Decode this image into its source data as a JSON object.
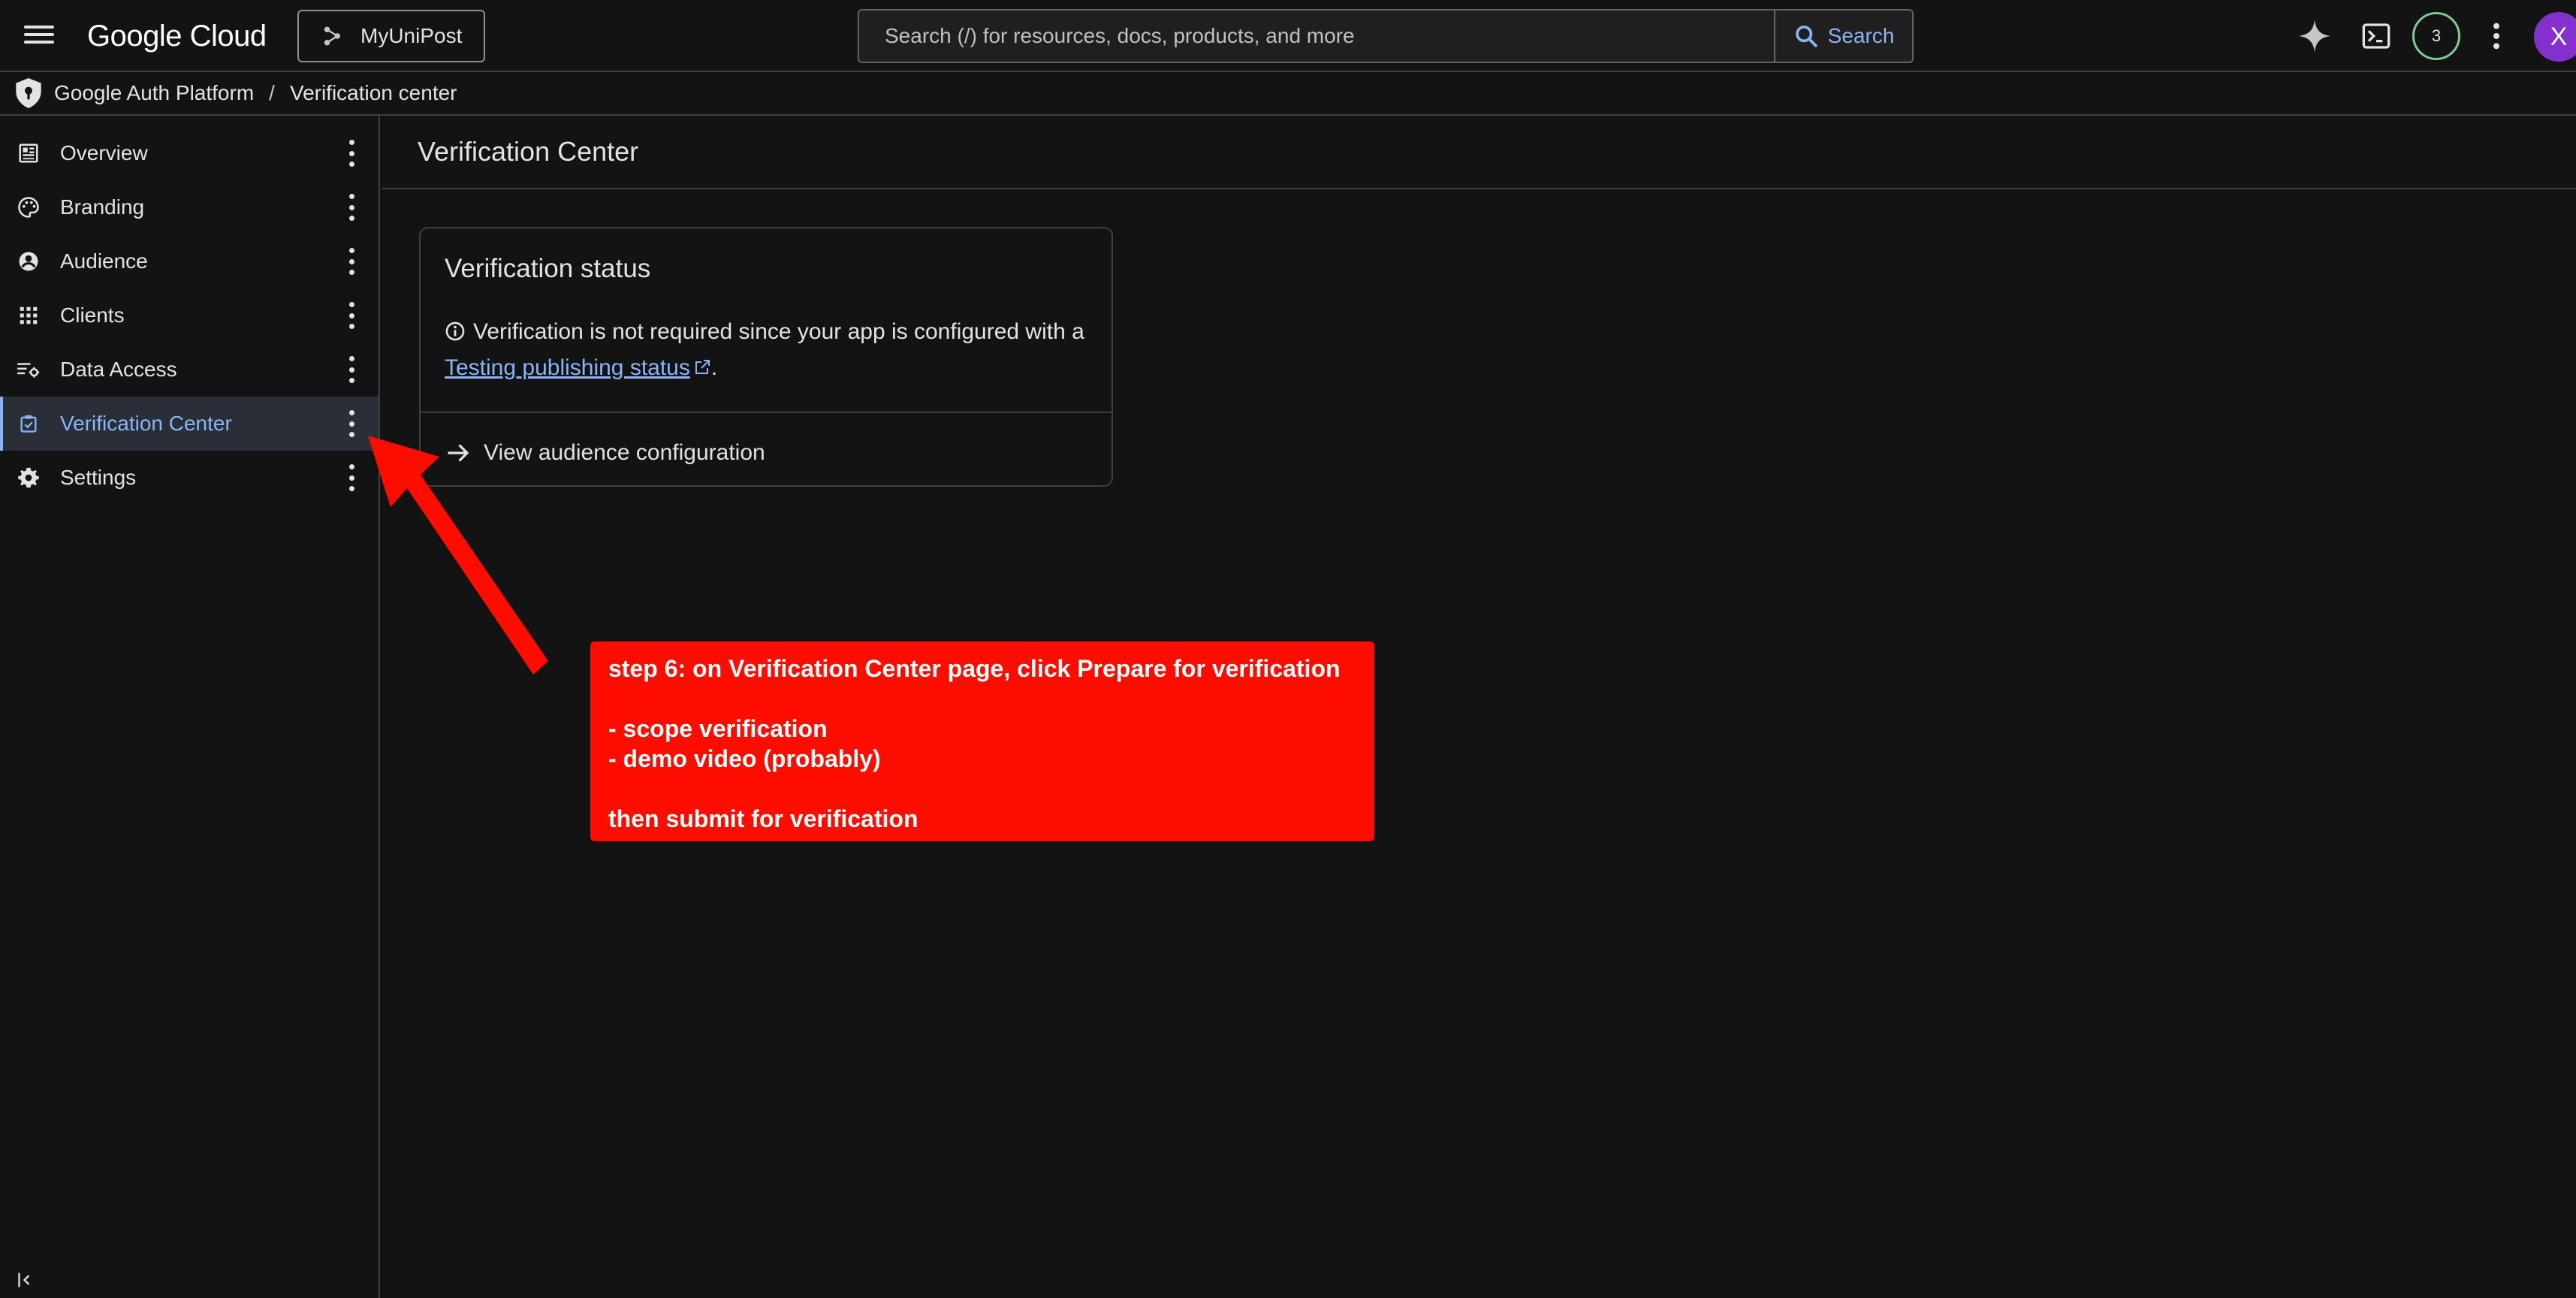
{
  "header": {
    "logo": "Google Cloud",
    "project_name": "MyUniPost",
    "search_placeholder": "Search (/) for resources, docs, products, and more",
    "search_button": "Search",
    "notification_count": "3",
    "avatar_initial": "X"
  },
  "breadcrumb": {
    "root": "Google Auth Platform",
    "current": "Verification center"
  },
  "sidebar": {
    "items": [
      {
        "label": "Overview",
        "icon": "dashboard-icon"
      },
      {
        "label": "Branding",
        "icon": "palette-icon"
      },
      {
        "label": "Audience",
        "icon": "account-circle-icon"
      },
      {
        "label": "Clients",
        "icon": "apps-grid-icon"
      },
      {
        "label": "Data Access",
        "icon": "tune-list-icon"
      },
      {
        "label": "Verification Center",
        "icon": "verified-check-icon",
        "active": true
      },
      {
        "label": "Settings",
        "icon": "gear-icon"
      }
    ]
  },
  "main": {
    "page_title": "Verification Center",
    "card": {
      "title": "Verification status",
      "text_before": "Verification is not required since your app is configured with a ",
      "link_text": "Testing publishing status",
      "text_after": ".",
      "action_label": "View audience configuration"
    }
  },
  "annotation": {
    "text": "step 6: on Verification Center page, click Prepare for verification\n\n- scope verification\n- demo video (probably)\n\nthen submit for verification",
    "color": "#ff0c00"
  },
  "colors": {
    "background": "#131314",
    "accent": "#8ab4f8",
    "badge_ring": "#81c995",
    "avatar": "#8430ce"
  }
}
